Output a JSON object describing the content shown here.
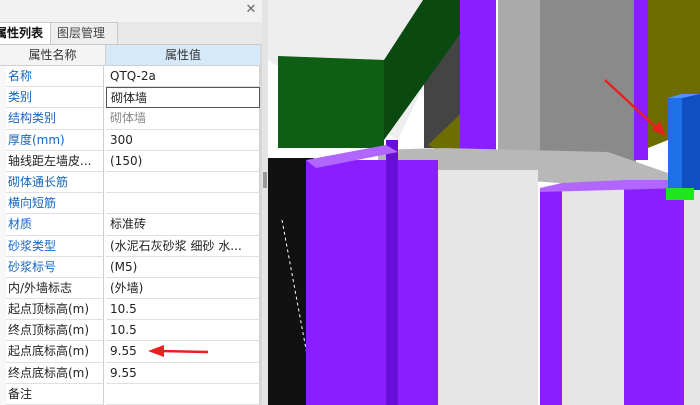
{
  "panel": {
    "tabs": [
      {
        "label": "属性列表",
        "active": true
      },
      {
        "label": "图层管理",
        "active": false
      }
    ],
    "close_icon": "close-icon"
  },
  "grid": {
    "header": {
      "name": "属性名称",
      "value": "属性值"
    },
    "rows": [
      {
        "name": "名称",
        "value": "QTQ-2a",
        "name_color": "blue"
      },
      {
        "name": "类别",
        "value": "砌体墙",
        "name_color": "blue",
        "editing": true
      },
      {
        "name": "结构类别",
        "value": "砌体墙",
        "name_color": "blue",
        "value_color": "grey"
      },
      {
        "name": "厚度(mm)",
        "value": "300",
        "name_color": "blue"
      },
      {
        "name": "轴线距左墙皮...",
        "value": "(150)",
        "name_color": "black"
      },
      {
        "name": "砌体通长筋",
        "value": "",
        "name_color": "blue"
      },
      {
        "name": "横向短筋",
        "value": "",
        "name_color": "blue"
      },
      {
        "name": "材质",
        "value": "标准砖",
        "name_color": "blue"
      },
      {
        "name": "砂浆类型",
        "value": "(水泥石灰砂浆 细砂  水...",
        "name_color": "blue"
      },
      {
        "name": "砂浆标号",
        "value": "(M5)",
        "name_color": "blue"
      },
      {
        "name": "内/外墙标志",
        "value": "(外墙)",
        "name_color": "black"
      },
      {
        "name": "起点顶标高(m)",
        "value": "10.5",
        "name_color": "black"
      },
      {
        "name": "终点顶标高(m)",
        "value": "10.5",
        "name_color": "black"
      },
      {
        "name": "起点底标高(m)",
        "value": "9.55",
        "name_color": "black"
      },
      {
        "name": "终点底标高(m)",
        "value": "9.55",
        "name_color": "black"
      },
      {
        "name": "备注",
        "value": "",
        "name_color": "black"
      }
    ]
  },
  "colors": {
    "wall_purple": "#8a1eff",
    "wall_dark_green": "#0e5e14",
    "wall_olive": "#6e6e00",
    "column_blue": "#1e6fe8",
    "marker_green": "#1fe61f",
    "annotation_red": "#e82020",
    "label_blue": "#1565c0"
  },
  "viewport": {
    "annotation": "red-arrow-icon"
  }
}
